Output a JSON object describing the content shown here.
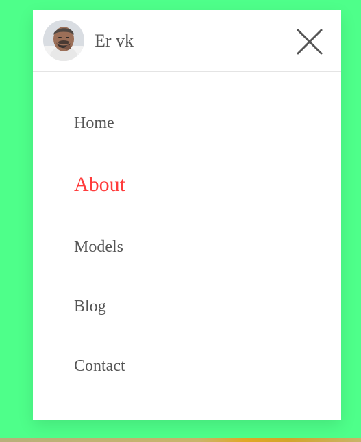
{
  "header": {
    "user_name": "Er vk",
    "avatar_alt": "Er vk avatar",
    "close_label": "Close menu"
  },
  "nav": {
    "items": [
      {
        "label": "Home",
        "active": false
      },
      {
        "label": "About",
        "active": true
      },
      {
        "label": "Models",
        "active": false
      },
      {
        "label": "Blog",
        "active": false
      },
      {
        "label": "Contact",
        "active": false
      }
    ]
  },
  "colors": {
    "background": "#4eff8a",
    "panel": "#ffffff",
    "text": "#555555",
    "active": "#ff3b3b"
  },
  "icons": {
    "avatar": "user-photo",
    "close": "close-icon"
  }
}
